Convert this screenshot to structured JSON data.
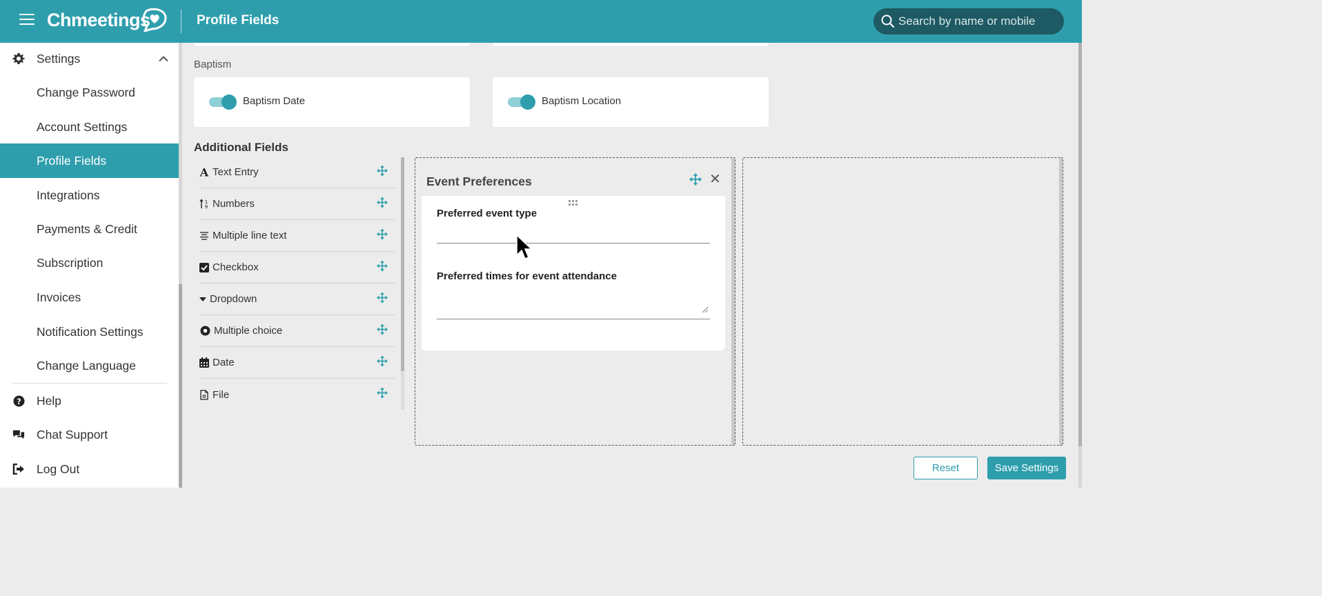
{
  "header": {
    "app_name": "Chmeetings",
    "page_title": "Profile Fields",
    "search_placeholder": "Search by name or mobile"
  },
  "sidebar": {
    "settings_label": "Settings",
    "items": [
      {
        "label": "Change Password"
      },
      {
        "label": "Account Settings"
      },
      {
        "label": "Profile Fields"
      },
      {
        "label": "Integrations"
      },
      {
        "label": "Payments & Credit"
      },
      {
        "label": "Subscription"
      },
      {
        "label": "Invoices"
      },
      {
        "label": "Notification Settings"
      },
      {
        "label": "Change Language"
      }
    ],
    "bottom": [
      {
        "label": "Help",
        "icon": "question-circle-icon"
      },
      {
        "label": "Chat Support",
        "icon": "chat-bubbles-icon"
      },
      {
        "label": "Log Out",
        "icon": "logout-icon"
      }
    ]
  },
  "baptism": {
    "section_label": "Baptism",
    "fields": [
      {
        "label": "Baptism Date",
        "enabled": true
      },
      {
        "label": "Baptism Location",
        "enabled": true
      }
    ]
  },
  "additional_fields": {
    "title": "Additional Fields",
    "types": [
      {
        "label": "Text Entry",
        "icon": "text-a-icon"
      },
      {
        "label": "Numbers",
        "icon": "numbers-sort-icon"
      },
      {
        "label": "Multiple line text",
        "icon": "align-lines-icon"
      },
      {
        "label": "Checkbox",
        "icon": "checkbox-icon"
      },
      {
        "label": "Dropdown",
        "icon": "caret-down-icon"
      },
      {
        "label": "Multiple choice",
        "icon": "radio-icon"
      },
      {
        "label": "Date",
        "icon": "calendar-icon"
      },
      {
        "label": "File",
        "icon": "file-icon"
      }
    ]
  },
  "panel": {
    "title": "Event Preferences",
    "fields": [
      {
        "label": "Preferred event type",
        "kind": "text"
      },
      {
        "label": "Preferred times for event attendance",
        "kind": "multiline"
      }
    ]
  },
  "actions": {
    "reset_label": "Reset",
    "save_label": "Save Settings"
  },
  "colors": {
    "brand": "#2e9ead",
    "search_bg": "#1e5a63",
    "toggle_track": "#8fcfd6"
  }
}
